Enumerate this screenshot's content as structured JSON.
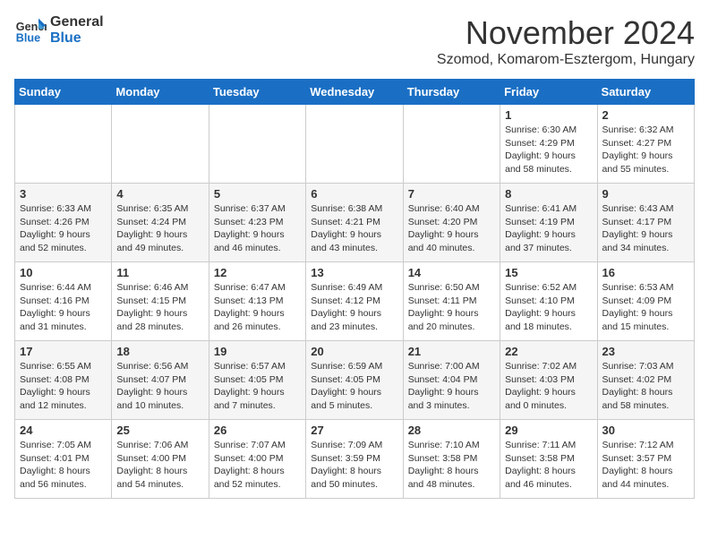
{
  "logo": {
    "line1": "General",
    "line2": "Blue"
  },
  "title": "November 2024",
  "subtitle": "Szomod, Komarom-Esztergom, Hungary",
  "days_header": [
    "Sunday",
    "Monday",
    "Tuesday",
    "Wednesday",
    "Thursday",
    "Friday",
    "Saturday"
  ],
  "weeks": [
    [
      {
        "day": "",
        "info": ""
      },
      {
        "day": "",
        "info": ""
      },
      {
        "day": "",
        "info": ""
      },
      {
        "day": "",
        "info": ""
      },
      {
        "day": "",
        "info": ""
      },
      {
        "day": "1",
        "info": "Sunrise: 6:30 AM\nSunset: 4:29 PM\nDaylight: 9 hours and 58 minutes."
      },
      {
        "day": "2",
        "info": "Sunrise: 6:32 AM\nSunset: 4:27 PM\nDaylight: 9 hours and 55 minutes."
      }
    ],
    [
      {
        "day": "3",
        "info": "Sunrise: 6:33 AM\nSunset: 4:26 PM\nDaylight: 9 hours and 52 minutes."
      },
      {
        "day": "4",
        "info": "Sunrise: 6:35 AM\nSunset: 4:24 PM\nDaylight: 9 hours and 49 minutes."
      },
      {
        "day": "5",
        "info": "Sunrise: 6:37 AM\nSunset: 4:23 PM\nDaylight: 9 hours and 46 minutes."
      },
      {
        "day": "6",
        "info": "Sunrise: 6:38 AM\nSunset: 4:21 PM\nDaylight: 9 hours and 43 minutes."
      },
      {
        "day": "7",
        "info": "Sunrise: 6:40 AM\nSunset: 4:20 PM\nDaylight: 9 hours and 40 minutes."
      },
      {
        "day": "8",
        "info": "Sunrise: 6:41 AM\nSunset: 4:19 PM\nDaylight: 9 hours and 37 minutes."
      },
      {
        "day": "9",
        "info": "Sunrise: 6:43 AM\nSunset: 4:17 PM\nDaylight: 9 hours and 34 minutes."
      }
    ],
    [
      {
        "day": "10",
        "info": "Sunrise: 6:44 AM\nSunset: 4:16 PM\nDaylight: 9 hours and 31 minutes."
      },
      {
        "day": "11",
        "info": "Sunrise: 6:46 AM\nSunset: 4:15 PM\nDaylight: 9 hours and 28 minutes."
      },
      {
        "day": "12",
        "info": "Sunrise: 6:47 AM\nSunset: 4:13 PM\nDaylight: 9 hours and 26 minutes."
      },
      {
        "day": "13",
        "info": "Sunrise: 6:49 AM\nSunset: 4:12 PM\nDaylight: 9 hours and 23 minutes."
      },
      {
        "day": "14",
        "info": "Sunrise: 6:50 AM\nSunset: 4:11 PM\nDaylight: 9 hours and 20 minutes."
      },
      {
        "day": "15",
        "info": "Sunrise: 6:52 AM\nSunset: 4:10 PM\nDaylight: 9 hours and 18 minutes."
      },
      {
        "day": "16",
        "info": "Sunrise: 6:53 AM\nSunset: 4:09 PM\nDaylight: 9 hours and 15 minutes."
      }
    ],
    [
      {
        "day": "17",
        "info": "Sunrise: 6:55 AM\nSunset: 4:08 PM\nDaylight: 9 hours and 12 minutes."
      },
      {
        "day": "18",
        "info": "Sunrise: 6:56 AM\nSunset: 4:07 PM\nDaylight: 9 hours and 10 minutes."
      },
      {
        "day": "19",
        "info": "Sunrise: 6:57 AM\nSunset: 4:05 PM\nDaylight: 9 hours and 7 minutes."
      },
      {
        "day": "20",
        "info": "Sunrise: 6:59 AM\nSunset: 4:05 PM\nDaylight: 9 hours and 5 minutes."
      },
      {
        "day": "21",
        "info": "Sunrise: 7:00 AM\nSunset: 4:04 PM\nDaylight: 9 hours and 3 minutes."
      },
      {
        "day": "22",
        "info": "Sunrise: 7:02 AM\nSunset: 4:03 PM\nDaylight: 9 hours and 0 minutes."
      },
      {
        "day": "23",
        "info": "Sunrise: 7:03 AM\nSunset: 4:02 PM\nDaylight: 8 hours and 58 minutes."
      }
    ],
    [
      {
        "day": "24",
        "info": "Sunrise: 7:05 AM\nSunset: 4:01 PM\nDaylight: 8 hours and 56 minutes."
      },
      {
        "day": "25",
        "info": "Sunrise: 7:06 AM\nSunset: 4:00 PM\nDaylight: 8 hours and 54 minutes."
      },
      {
        "day": "26",
        "info": "Sunrise: 7:07 AM\nSunset: 4:00 PM\nDaylight: 8 hours and 52 minutes."
      },
      {
        "day": "27",
        "info": "Sunrise: 7:09 AM\nSunset: 3:59 PM\nDaylight: 8 hours and 50 minutes."
      },
      {
        "day": "28",
        "info": "Sunrise: 7:10 AM\nSunset: 3:58 PM\nDaylight: 8 hours and 48 minutes."
      },
      {
        "day": "29",
        "info": "Sunrise: 7:11 AM\nSunset: 3:58 PM\nDaylight: 8 hours and 46 minutes."
      },
      {
        "day": "30",
        "info": "Sunrise: 7:12 AM\nSunset: 3:57 PM\nDaylight: 8 hours and 44 minutes."
      }
    ]
  ]
}
